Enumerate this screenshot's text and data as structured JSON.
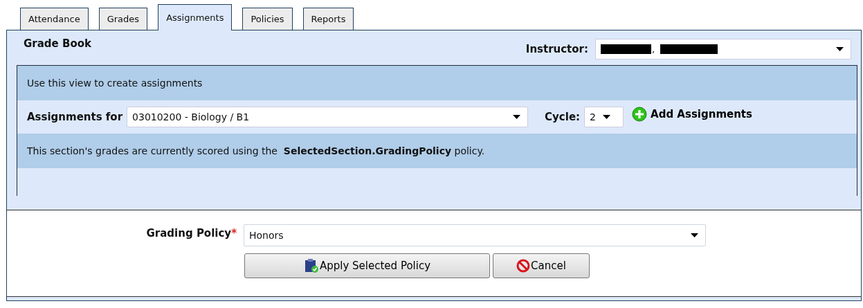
{
  "tabs": [
    {
      "label": "Attendance",
      "selected": false
    },
    {
      "label": "Grades",
      "selected": false
    },
    {
      "label": "Assignments",
      "selected": true
    },
    {
      "label": "Policies",
      "selected": false
    },
    {
      "label": "Reports",
      "selected": false
    }
  ],
  "header": {
    "title": "Grade Book",
    "instructor_label": "Instructor:",
    "instructor_separator": ","
  },
  "intro": "Use this view to create assignments",
  "assignments_for": {
    "label": "Assignments for",
    "value": "03010200 - Biology / B1",
    "cycle_label": "Cycle:",
    "cycle_value": "2",
    "add_button": "Add Assignments"
  },
  "policy_note": "This section's grades are currently scored using the  **SelectedSection.GradingPolicy** policy.",
  "form": {
    "label": "Grading Policy",
    "required_mark": "*",
    "value": "Honors",
    "buttons": [
      {
        "kind": "apply",
        "label": "Apply Selected Policy"
      },
      {
        "kind": "cancel",
        "label": "Cancel"
      }
    ]
  }
}
